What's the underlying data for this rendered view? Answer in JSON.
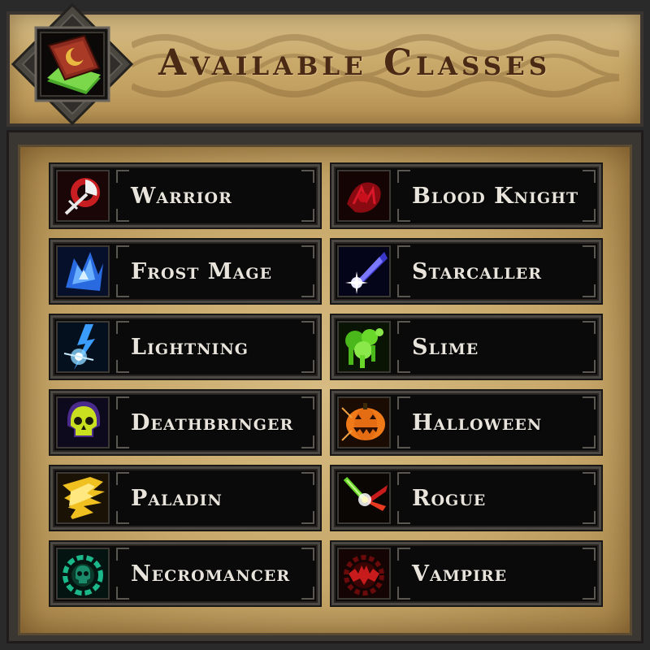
{
  "header": {
    "title": "Available Classes",
    "emblem_icon": "spellbook-icon"
  },
  "classes": [
    {
      "label": "Warrior",
      "icon": "warrior-axe-icon",
      "color": "#d8282a"
    },
    {
      "label": "Blood Knight",
      "icon": "blood-knight-icon",
      "color": "#b0101a"
    },
    {
      "label": "Frost Mage",
      "icon": "frost-crystal-icon",
      "color": "#3a8cff"
    },
    {
      "label": "Starcaller",
      "icon": "falling-star-icon",
      "color": "#5a5aff"
    },
    {
      "label": "Lightning",
      "icon": "lightning-bolt-icon",
      "color": "#4ab8ff"
    },
    {
      "label": "Slime",
      "icon": "slime-splash-icon",
      "color": "#6ae02a"
    },
    {
      "label": "Deathbringer",
      "icon": "yellow-skull-icon",
      "color": "#c8e020"
    },
    {
      "label": "Halloween",
      "icon": "jack-o-lantern-icon",
      "color": "#f07a18"
    },
    {
      "label": "Paladin",
      "icon": "holy-wing-icon",
      "color": "#f0c020"
    },
    {
      "label": "Rogue",
      "icon": "dagger-strike-icon",
      "color": "#e83a20"
    },
    {
      "label": "Necromancer",
      "icon": "green-skull-icon",
      "color": "#1ab88a"
    },
    {
      "label": "Vampire",
      "icon": "vampire-bat-icon",
      "color": "#c81c1c"
    }
  ]
}
